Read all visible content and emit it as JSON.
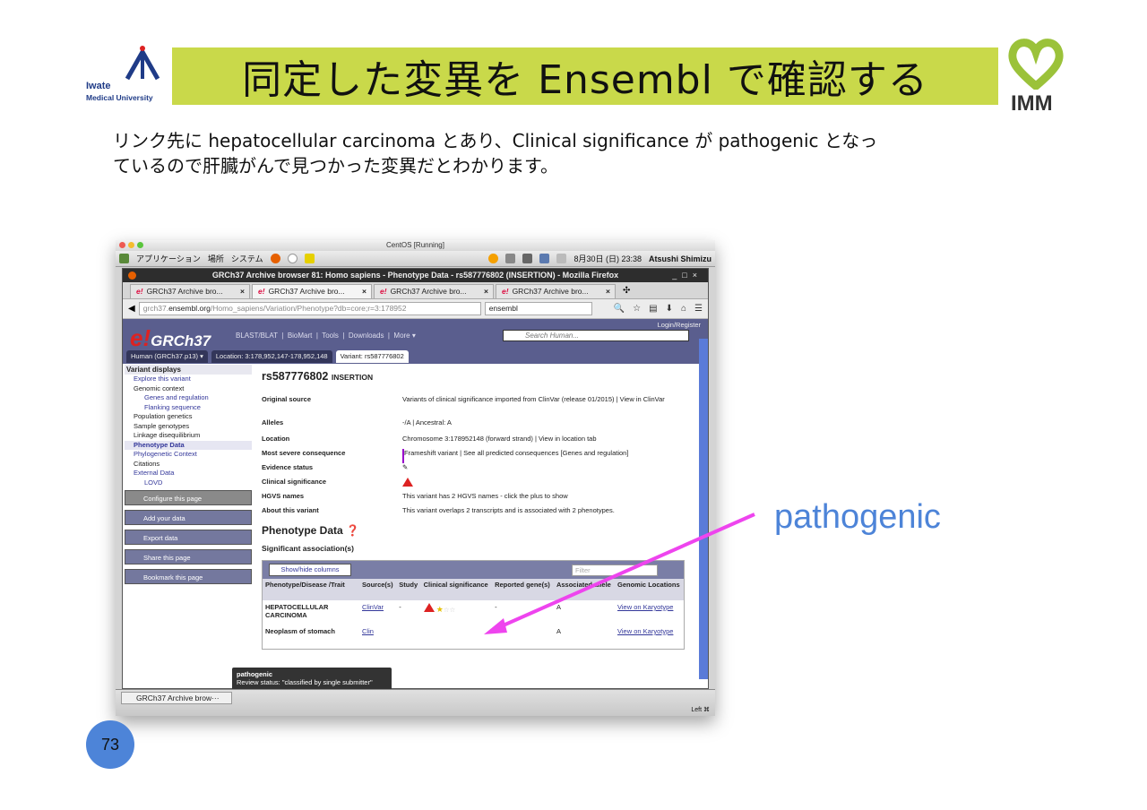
{
  "slide": {
    "logo_left": {
      "line1": "Iwate",
      "line2": "Medical University"
    },
    "title": "同定した変異を Ensembl で確認する",
    "logo_right": "IMM",
    "description_line1": "リンク先に hepatocellular carcinoma とあり、Clinical significance が pathogenic となっ",
    "description_line2": "ているので肝臓がんで見つかった変異だとわかります。",
    "annotation": "pathogenic",
    "page_number": "73",
    "accent_color": "#c9d94a",
    "annotation_color": "#4d84d8",
    "arrow_color": "#ee44ee"
  },
  "vm": {
    "title": "CentOS [Running]",
    "gnome": {
      "apps": "アプリケーション",
      "places": "場所",
      "system": "システム",
      "datetime": "8月30日 (日) 23:38",
      "user": "Atsushi Shimizu"
    },
    "firefox": {
      "window_title": "GRCh37 Archive browser 81: Homo sapiens - Phenotype Data - rs587776802 (INSERTION) - Mozilla Firefox",
      "tabs": [
        "GRCh37 Archive bro...",
        "GRCh37 Archive bro...",
        "GRCh37 Archive bro...",
        "GRCh37 Archive bro..."
      ],
      "url_prefix": "grch37.",
      "url_domain": "ensembl.org",
      "url_rest": "/Homo_sapiens/Variation/Phenotype?db=core;r=3:178952",
      "search_engine_value": "ensembl"
    },
    "ensembl": {
      "logo_text": "GRCh37",
      "menu": [
        "BLAST/BLAT",
        "BioMart",
        "Tools",
        "Downloads",
        "More ▾"
      ],
      "login": "Login/Register",
      "search_placeholder": "Search Human...",
      "location_tabs": [
        "Human (GRCh37.p13) ▾",
        "Location: 3:178,952,147-178,952,148",
        "Variant: rs587776802"
      ],
      "sidebar": {
        "heading": "Variant displays",
        "items": [
          {
            "label": "Explore this variant",
            "level": 1
          },
          {
            "label": "Genomic context",
            "level": 1
          },
          {
            "label": "Genes and regulation",
            "level": 2
          },
          {
            "label": "Flanking sequence",
            "level": 2
          },
          {
            "label": "Population genetics",
            "level": 1
          },
          {
            "label": "Sample genotypes",
            "level": 1
          },
          {
            "label": "Linkage disequilibrium",
            "level": 1
          },
          {
            "label": "Phenotype Data",
            "level": 1
          },
          {
            "label": "Phylogenetic Context",
            "level": 1
          },
          {
            "label": "Citations",
            "level": 1
          },
          {
            "label": "External Data",
            "level": 1
          },
          {
            "label": "LOVD",
            "level": 2
          }
        ],
        "buttons": [
          "Configure this page",
          "Add your data",
          "Export data",
          "Share this page",
          "Bookmark this page"
        ]
      },
      "variant_id": "rs587776802",
      "variant_type": "INSERTION",
      "summary": [
        {
          "key": "Original source",
          "value": "Variants of clinical significance imported from ClinVar (release 01/2015) | View in ClinVar"
        },
        {
          "key": "Alleles",
          "value": "-/A | Ancestral: A"
        },
        {
          "key": "Location",
          "value": "Chromosome 3:178952148 (forward strand) | View in location tab"
        },
        {
          "key": "Most severe consequence",
          "value": "Frameshift variant | See all predicted consequences [Genes and regulation]"
        },
        {
          "key": "Evidence status",
          "value": ""
        },
        {
          "key": "Clinical significance",
          "value": ""
        },
        {
          "key": "HGVS names",
          "value": "This variant has 2 HGVS names - click the plus to show"
        },
        {
          "key": "About this variant",
          "value": "This variant overlaps 2 transcripts and is associated with 2 phenotypes."
        }
      ],
      "phenotype_title": "Phenotype Data",
      "assoc_title": "Significant association(s)",
      "show_hide": "Show/hide columns",
      "filter_placeholder": "Filter",
      "table_headers": [
        "Phenotype/Disease /Trait",
        "Source(s)",
        "Study",
        "Clinical significance",
        "Reported gene(s)",
        "Associated allele",
        "Genomic Locations"
      ],
      "rows": [
        {
          "trait": "HEPATOCELLULAR CARCINOMA",
          "source": "ClinVar",
          "study": "-",
          "gene": "-",
          "allele": "A",
          "loc": "View on Karyotype"
        },
        {
          "trait": "Neoplasm of stomach",
          "source": "Clin",
          "study": "",
          "gene": "",
          "allele": "A",
          "loc": "View on Karyotype"
        }
      ],
      "tooltip": {
        "title": "pathogenic",
        "body": "Review status: \"classified by single submitter\""
      }
    },
    "taskbar_item": "GRCh37 Archive brow···",
    "host_key": "Left ⌘"
  }
}
